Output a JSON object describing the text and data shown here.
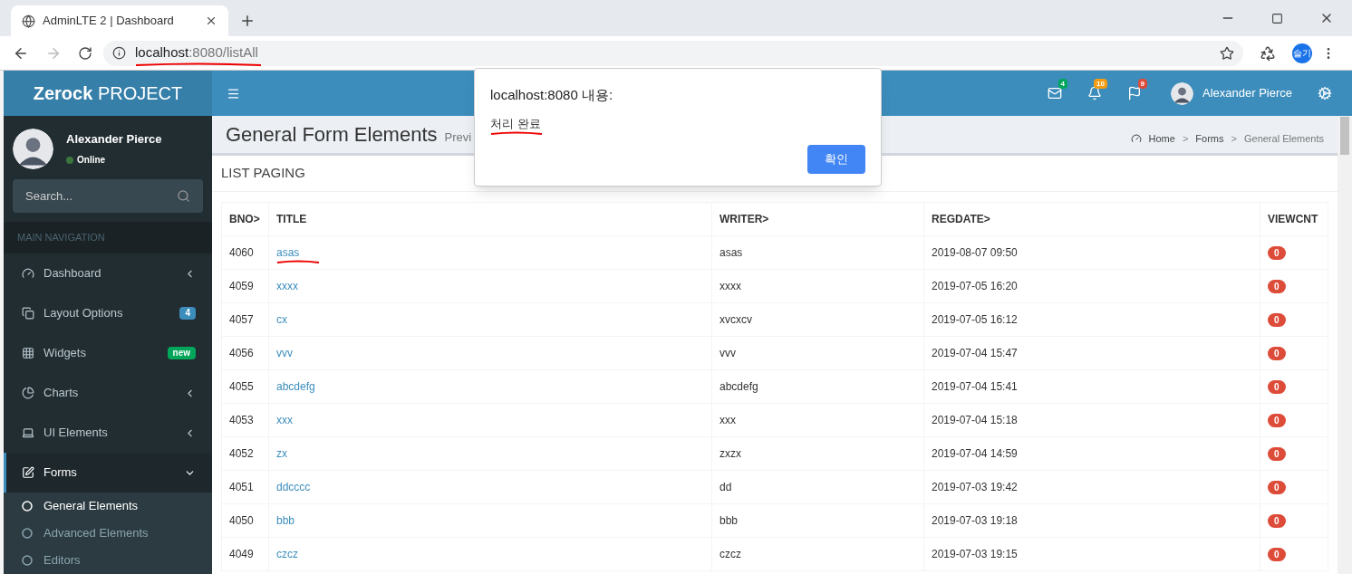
{
  "browser": {
    "tab_title": "AdminLTE 2 | Dashboard",
    "url_host": "localhost",
    "url_rest": ":8080/listAll",
    "profile": "슬기"
  },
  "header": {
    "logo_bold": "Zerock",
    "logo_rest": "PROJECT",
    "user_name": "Alexander Pierce",
    "notifications": [
      {
        "kind": "mail",
        "count": "4",
        "color": "#00a65a"
      },
      {
        "kind": "bell",
        "count": "10",
        "color": "#f39c12"
      },
      {
        "kind": "flag",
        "count": "9",
        "color": "#dd4b39"
      }
    ]
  },
  "sidebar": {
    "user_name": "Alexander Pierce",
    "status": "Online",
    "search": {
      "placeholder": "Search..."
    },
    "nav_header": "MAIN NAVIGATION",
    "items": [
      {
        "label": "Dashboard",
        "kind": "chevron",
        "selected": false
      },
      {
        "label": "Layout Options",
        "kind": "badge",
        "badge": "4",
        "color": "#3c8dbc",
        "selected": false
      },
      {
        "label": "Widgets",
        "kind": "badge",
        "badge": "new",
        "color": "#00a65a",
        "selected": false
      },
      {
        "label": "Charts",
        "kind": "chevron",
        "selected": false
      },
      {
        "label": "UI Elements",
        "kind": "chevron",
        "selected": false
      },
      {
        "label": "Forms",
        "kind": "expanded",
        "selected": true,
        "children": [
          {
            "label": "General Elements",
            "selected": true
          },
          {
            "label": "Advanced Elements",
            "selected": false
          },
          {
            "label": "Editors",
            "selected": false
          }
        ]
      }
    ]
  },
  "content": {
    "title": "General Form Elements",
    "subtitle": "Previ",
    "breadcrumbs": [
      "Home",
      "Forms",
      "General Elements"
    ],
    "breadcrumb_separator": ">",
    "box_title": "LIST PAGING",
    "table": {
      "columns": [
        "BNO>",
        "TITLE",
        "WRITER>",
        "REGDATE>",
        "VIEWCNT"
      ],
      "rows": [
        {
          "bno": "4060",
          "title": "asas",
          "writer": "asas",
          "regdate": "2019-08-07 09:50",
          "viewcnt": "0"
        },
        {
          "bno": "4059",
          "title": "xxxx",
          "writer": "xxxx",
          "regdate": "2019-07-05 16:20",
          "viewcnt": "0"
        },
        {
          "bno": "4057",
          "title": "cx",
          "writer": "xvcxcv",
          "regdate": "2019-07-05 16:12",
          "viewcnt": "0"
        },
        {
          "bno": "4056",
          "title": "vvv",
          "writer": "vvv",
          "regdate": "2019-07-04 15:47",
          "viewcnt": "0"
        },
        {
          "bno": "4055",
          "title": "abcdefg",
          "writer": "abcdefg",
          "regdate": "2019-07-04 15:41",
          "viewcnt": "0"
        },
        {
          "bno": "4053",
          "title": "xxx",
          "writer": "xxx",
          "regdate": "2019-07-04 15:18",
          "viewcnt": "0"
        },
        {
          "bno": "4052",
          "title": "zx",
          "writer": "zxzx",
          "regdate": "2019-07-04 14:59",
          "viewcnt": "0"
        },
        {
          "bno": "4051",
          "title": "ddcccc",
          "writer": "dd",
          "regdate": "2019-07-03 19:42",
          "viewcnt": "0"
        },
        {
          "bno": "4050",
          "title": "bbb",
          "writer": "bbb",
          "regdate": "2019-07-03 19:18",
          "viewcnt": "0"
        },
        {
          "bno": "4049",
          "title": "czcz",
          "writer": "czcz",
          "regdate": "2019-07-03 19:15",
          "viewcnt": "0"
        }
      ]
    }
  },
  "alert": {
    "title": "localhost:8080 내용:",
    "message": "처리 완료",
    "button": "확인"
  }
}
